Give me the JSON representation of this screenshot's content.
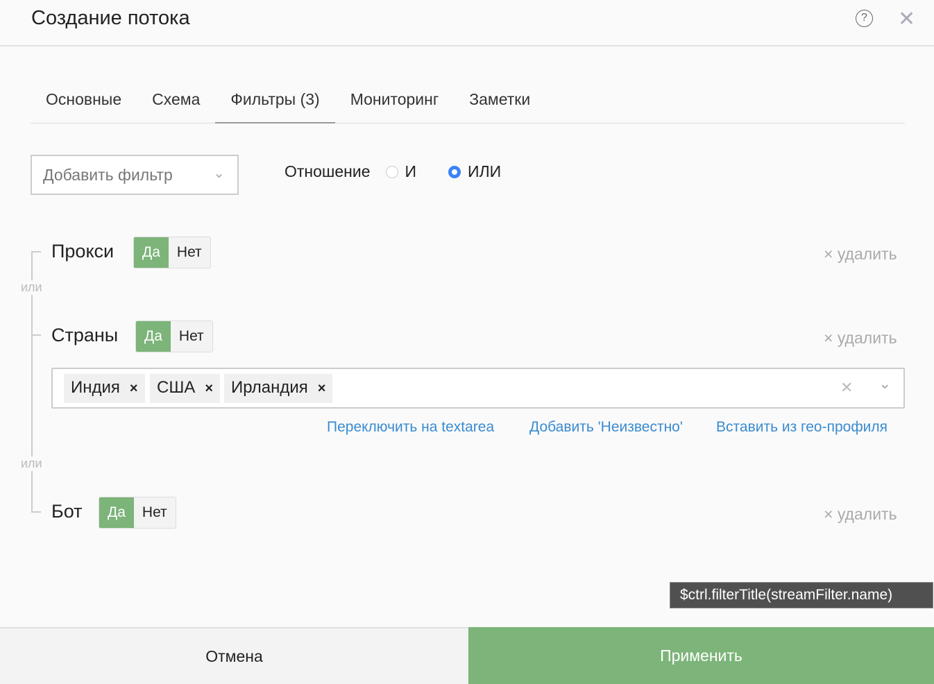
{
  "header": {
    "title": "Создание потока",
    "help": "?",
    "close": "✕"
  },
  "tabs": [
    "Основные",
    "Схема",
    "Фильтры (3)",
    "Мониторинг",
    "Заметки"
  ],
  "add_filter": {
    "placeholder": "Добавить фильтр",
    "chevron": "⌄"
  },
  "relation": {
    "label": "Отношение",
    "options": [
      "И",
      "ИЛИ"
    ],
    "selected": "ИЛИ"
  },
  "or_label": "или",
  "filters": [
    {
      "name": "Прокси",
      "yes": "Да",
      "no": "Нет",
      "selected": "Да",
      "delete": "× удалить"
    },
    {
      "name": "Страны",
      "yes": "Да",
      "no": "Нет",
      "selected": "Да",
      "delete": "× удалить",
      "tags": [
        "Индия",
        "США",
        "Ирландия"
      ],
      "tag_remove": "×",
      "clear": "✕",
      "links": [
        "Переключить на textarea",
        "Добавить 'Неизвестно'",
        "Вставить из гео-профиля"
      ]
    },
    {
      "name": "Бот",
      "yes": "Да",
      "no": "Нет",
      "selected": "Да",
      "delete": "× удалить"
    }
  ],
  "tooltip": "$ctrl.filterTitle(streamFilter.name)",
  "footer": {
    "cancel": "Отмена",
    "apply": "Применить"
  },
  "colors": {
    "accent_green": "#7cb479",
    "link_blue": "#3a8bd0",
    "radio_blue": "#3b82f6"
  }
}
